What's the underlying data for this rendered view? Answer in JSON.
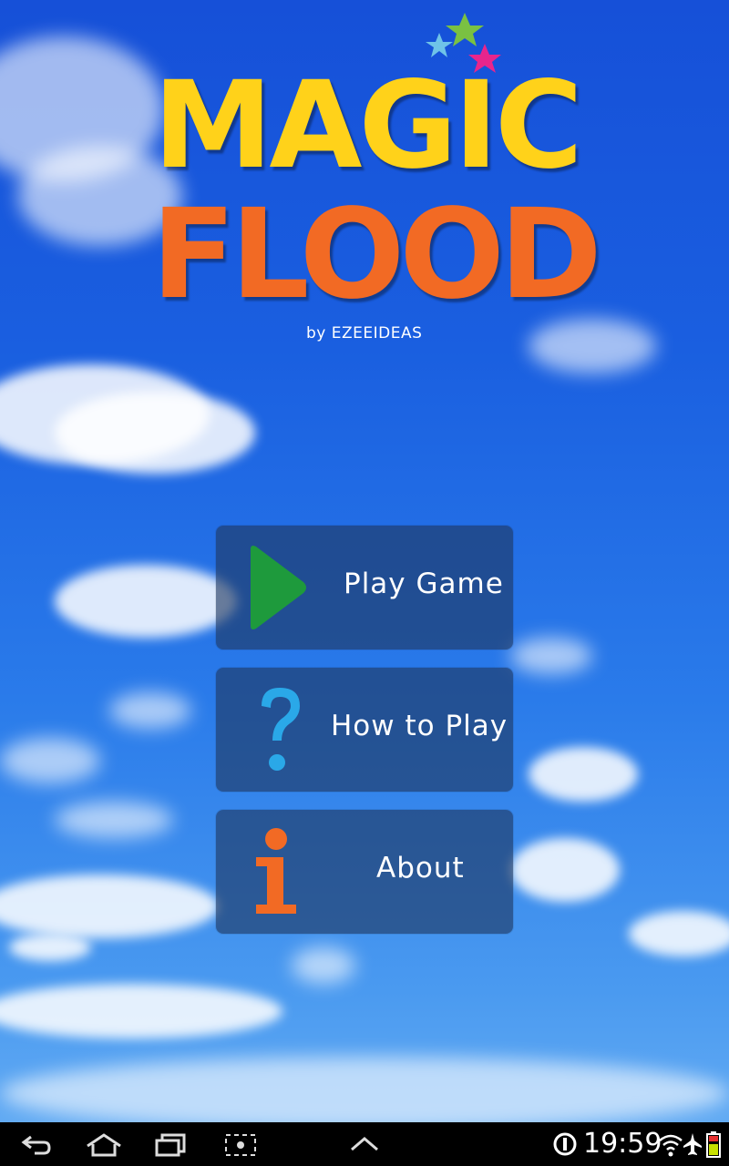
{
  "logo": {
    "line1": "MAGIC",
    "line2": "FLOOD",
    "byline": "by EZEEIDEAS",
    "colors": {
      "magic": "#ffd21a",
      "flood": "#f26a24"
    }
  },
  "menu": {
    "items": [
      {
        "label": "Play Game",
        "icon": "play-icon",
        "color": "#1e9a3c"
      },
      {
        "label": "How to Play",
        "icon": "question-icon",
        "color": "#2aa8e8"
      },
      {
        "label": "About",
        "icon": "info-icon",
        "color": "#f26a24"
      }
    ]
  },
  "statusbar": {
    "time": "19:59",
    "icons": [
      "back-icon",
      "home-icon",
      "recent-apps-icon",
      "screenshot-icon",
      "up-arrow-icon",
      "settings-icon",
      "wifi-icon",
      "airplane-icon",
      "battery-icon"
    ]
  }
}
